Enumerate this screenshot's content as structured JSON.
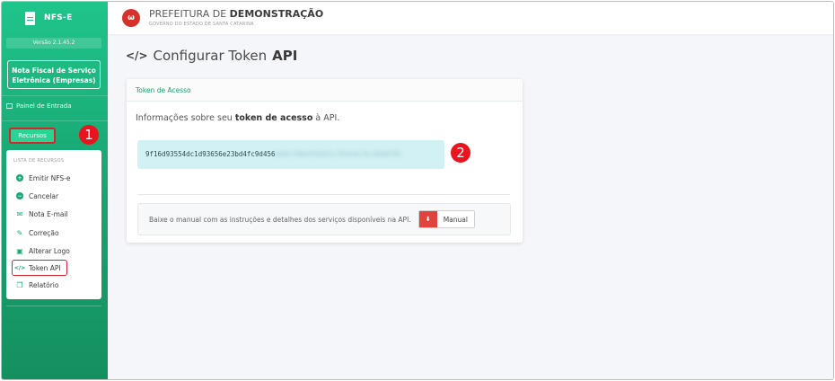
{
  "sidebar": {
    "brand": "NFS-E",
    "version": "Versão 2.1.45.2",
    "nfse_title": "Nota Fiscal de Serviço Eletrônica (Empresas)",
    "painel": "Painel de Entrada",
    "recursos": "Recursos",
    "menu_heading": "LISTA DE RECURSOS",
    "items": [
      {
        "label": "Emitir NFS-e",
        "icon": "plus-circle-icon"
      },
      {
        "label": "Cancelar",
        "icon": "minus-circle-icon"
      },
      {
        "label": "Nota E-mail",
        "icon": "envelope-icon"
      },
      {
        "label": "Correção",
        "icon": "edit-icon"
      },
      {
        "label": "Alterar Logo",
        "icon": "image-icon"
      },
      {
        "label": "Token API",
        "icon": "code-icon"
      },
      {
        "label": "Relatório",
        "icon": "copy-icon"
      }
    ]
  },
  "annotations": {
    "one": "1",
    "two": "2"
  },
  "header": {
    "title_prefix": "PREFEITURA DE",
    "title_bold": "DEMONSTRAÇÃO",
    "subtitle": "GOVERNO DO ESTADO DE SANTA CATARINA"
  },
  "page": {
    "title_prefix": "Configurar Token",
    "title_bold": "API"
  },
  "card": {
    "header": "Token de Acesso",
    "info_prefix": "Informações sobre seu",
    "info_bold": "token de acesso",
    "info_suffix": "à API.",
    "token_visible": "9f16d93554dc1d93656e23bd4fc9d456",
    "token_blurred": "6a9c7d8e4f02b1c763e4a7bcd9e8f03",
    "manual_text": "Baixe o manual com as instruções e detalhes dos serviços disponíveis na API.",
    "manual_button": "Manual"
  },
  "colors": {
    "accent": "#19a772",
    "highlight": "#d9232a",
    "token_bg": "#d2f1f4"
  }
}
